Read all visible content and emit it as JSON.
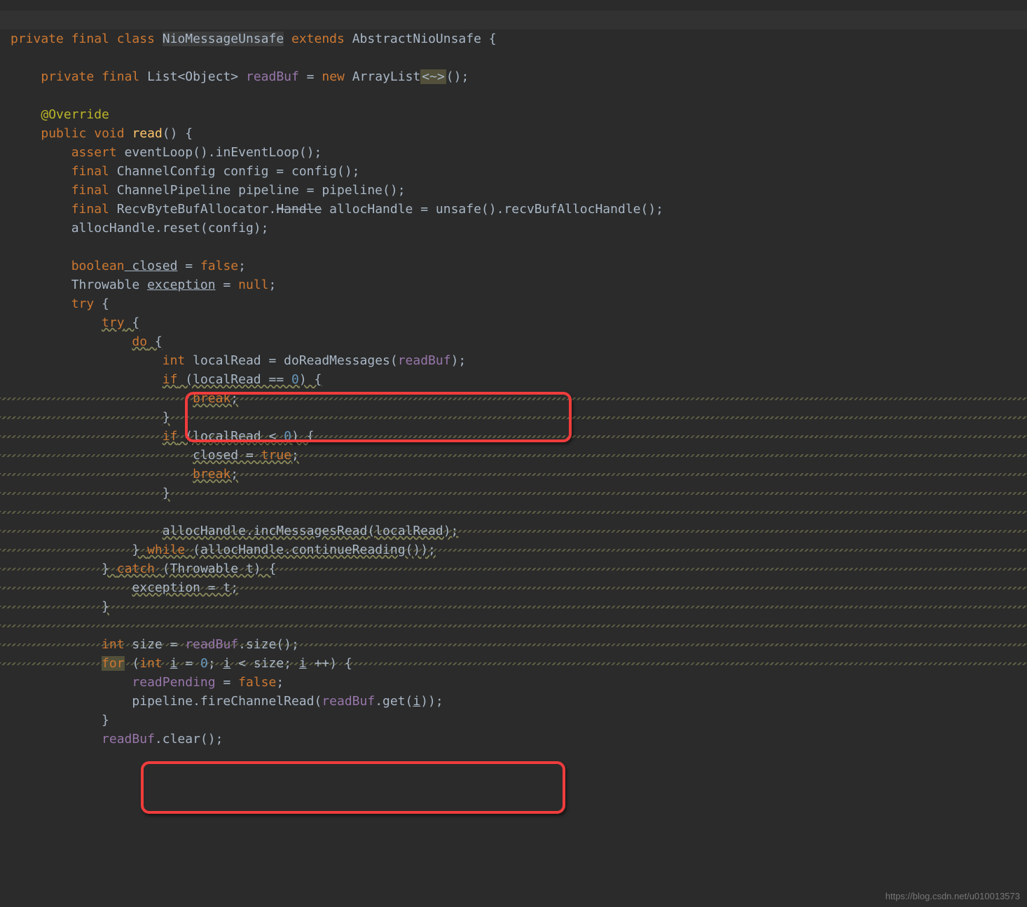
{
  "code": {
    "l1": {
      "kw_private": "private",
      "kw_final": "final",
      "kw_class": "class",
      "cls_name": "NioMessageUnsafe",
      "kw_extends": "extends",
      "super_cls": "AbstractNioUnsafe",
      "brace": " {"
    },
    "l3": {
      "kw_private": "private",
      "kw_final": "final",
      "type": "List<Object>",
      "field": "readBuf",
      "eq": " = ",
      "kw_new": "new",
      "ctor": "ArrayList",
      "diamond": "<~>",
      "tail": "();"
    },
    "l5": {
      "ann": "@Override"
    },
    "l6": {
      "kw_public": "public",
      "kw_void": "void",
      "mname": "read",
      "parens": "() {"
    },
    "l7": {
      "kw_assert": "assert",
      "call": " eventLoop().inEventLoop();"
    },
    "l8": {
      "kw_final": "final",
      "rest": " ChannelConfig config = config();"
    },
    "l9": {
      "kw_final": "final",
      "rest": " ChannelPipeline pipeline = pipeline();"
    },
    "l10": {
      "kw_final": "final",
      "type1": " RecvByteBufAllocator.",
      "handle": "Handle",
      "rest": " allocHandle = unsafe().recvBufAllocHandle();"
    },
    "l11": {
      "text": "allocHandle.reset(config);"
    },
    "l13": {
      "kw_bool": "boolean",
      "var": " closed",
      "eq": " = ",
      "kw_false": "false",
      "semi": ";"
    },
    "l14": {
      "type": "Throwable ",
      "var": "exception",
      "rest": " = ",
      "kw_null": "null",
      "semi": ";"
    },
    "l15": {
      "kw_try": "try",
      "brace": " {"
    },
    "l16": {
      "kw_try": "try",
      "brace": " {"
    },
    "l17": {
      "kw_do": "do",
      "brace": " {"
    },
    "l18": {
      "kw_int": "int",
      "var": " localRead = doReadMessages(",
      "arg": "readBuf",
      "tail": ");"
    },
    "l19": {
      "kw_if": "if",
      "cond1": " (localRead == ",
      "num0": "0",
      "cond2": ") {"
    },
    "l20": {
      "kw_break": "break",
      "semi": ";"
    },
    "l21": {
      "brace": "}"
    },
    "l22": {
      "kw_if": "if",
      "cond1": " (localRead < ",
      "num0": "0",
      "cond2": ") {"
    },
    "l23": {
      "lhs": "closed = ",
      "kw_true": "true",
      "semi": ";"
    },
    "l24": {
      "kw_break": "break",
      "semi": ";"
    },
    "l25": {
      "brace": "}"
    },
    "l27": {
      "text": "allocHandle.incMessagesRead(localRead);"
    },
    "l28": {
      "brace": "} ",
      "kw_while": "while",
      "cond": " (allocHandle.continueReading());"
    },
    "l29": {
      "brace": "} ",
      "kw_catch": "catch",
      "cond": " (Throwable t) {"
    },
    "l30": {
      "text": "exception = t;"
    },
    "l31": {
      "brace": "}"
    },
    "l33": {
      "kw_int": "int",
      "rest": " size = ",
      "field": "readBuf",
      "call": ".size();"
    },
    "l34": {
      "kw_for": "for",
      "p1": " (",
      "kw_int": "int",
      "sp": " ",
      "i1": "i",
      "eq": " = ",
      "num0": "0",
      "semi1": "; ",
      "i2": "i",
      "lt": " < size; ",
      "i3": "i",
      "inc": " ++) {"
    },
    "l35": {
      "field": "readPending",
      "rest": " = ",
      "kw_false": "false",
      "semi": ";"
    },
    "l36": {
      "call1": "pipeline.fireChannelRead(",
      "field": "readBuf",
      "call2": ".get(",
      "i": "i",
      "tail": "));"
    },
    "l37": {
      "brace": "}"
    },
    "l38": {
      "field": "readBuf",
      "call": ".clear();"
    }
  },
  "watermark": "https://blog.csdn.net/u010013573"
}
